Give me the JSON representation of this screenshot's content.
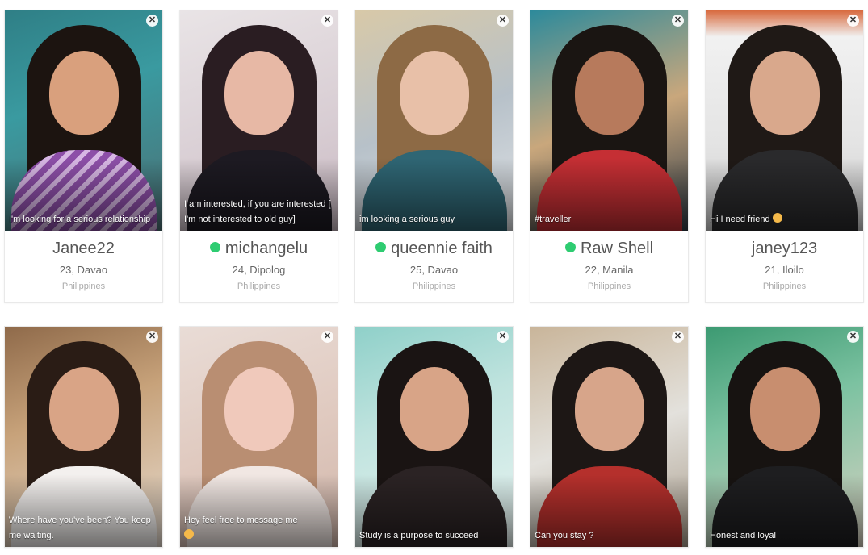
{
  "colors": {
    "online": "#2ecc71",
    "name_text": "#555555",
    "secondary_text": "#666666",
    "country_text": "#aaaaaa"
  },
  "close_glyph": "✕",
  "profiles": [
    {
      "caption": "I'm looking for a serious relationship",
      "name": "Janee22",
      "online": false,
      "age_city": "23, Davao",
      "country": "Philippines"
    },
    {
      "caption": "I am interested, if you are interested [ I'm not interested to old guy]",
      "name": "michangelu",
      "online": true,
      "age_city": "24, Dipolog",
      "country": "Philippines"
    },
    {
      "caption": "im looking a serious guy",
      "name": "queennie faith",
      "online": true,
      "age_city": "25, Davao",
      "country": "Philippines"
    },
    {
      "caption": "#traveller",
      "name": "Raw Shell",
      "online": true,
      "age_city": "22, Manila",
      "country": "Philippines"
    },
    {
      "caption": "Hi I need friend",
      "caption_emoji": "smile-emoji",
      "name": "janey123",
      "online": false,
      "age_city": "21, Iloilo",
      "country": "Philippines"
    },
    {
      "caption": "Where have you've been? You keep me waiting."
    },
    {
      "caption": "Hey feel free to message me",
      "caption_emoji": "smile-emoji"
    },
    {
      "caption": "Study is a purpose to succeed"
    },
    {
      "caption": "Can you stay ?"
    },
    {
      "caption": "Honest and loyal"
    }
  ]
}
